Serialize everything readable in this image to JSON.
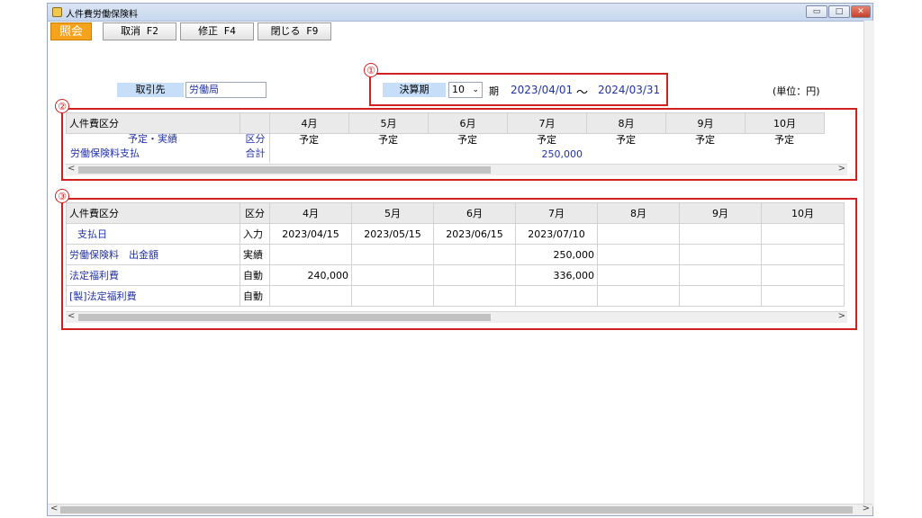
{
  "window": {
    "title": "人件費労働保険料"
  },
  "toolbar": {
    "mode": "照会",
    "cancel": "取消 F2",
    "modify": "修正 F4",
    "close": "閉じる F9"
  },
  "header": {
    "partner_label": "取引先",
    "partner_value": "労働局",
    "period_label": "決算期",
    "period_value": "10",
    "period_unit": "期",
    "date_from": "2023/04/01",
    "tilde": "～",
    "date_to": "2024/03/31",
    "unit": "(単位：円)"
  },
  "annotations": [
    "①",
    "②",
    "③"
  ],
  "section2": {
    "header": [
      "人件費区分",
      "",
      "4月",
      "5月",
      "6月",
      "7月",
      "8月",
      "9月",
      "10月"
    ],
    "row1": [
      "予定・実績",
      "区分",
      "予定",
      "予定",
      "予定",
      "予定",
      "予定",
      "予定",
      "予定"
    ],
    "row2": [
      "労働保険料支払",
      "合計",
      "",
      "",
      "",
      "250,000",
      "",
      "",
      ""
    ]
  },
  "section3": {
    "header": [
      "人件費区分",
      "区分",
      "4月",
      "5月",
      "6月",
      "7月",
      "8月",
      "9月",
      "10月"
    ],
    "rows": [
      [
        "支払日",
        "入力",
        "2023/04/15",
        "2023/05/15",
        "2023/06/15",
        "2023/07/10",
        "",
        "",
        ""
      ],
      [
        "労働保険料　出金額",
        "実績",
        "",
        "",
        "",
        "250,000",
        "",
        "",
        ""
      ],
      [
        "法定福利費",
        "自動",
        "240,000",
        "",
        "",
        "336,000",
        "",
        "",
        ""
      ],
      [
        "[製]法定福利費",
        "自動",
        "",
        "",
        "",
        "",
        "",
        "",
        ""
      ]
    ]
  },
  "scroll": {
    "left": "<",
    "right": ">"
  }
}
